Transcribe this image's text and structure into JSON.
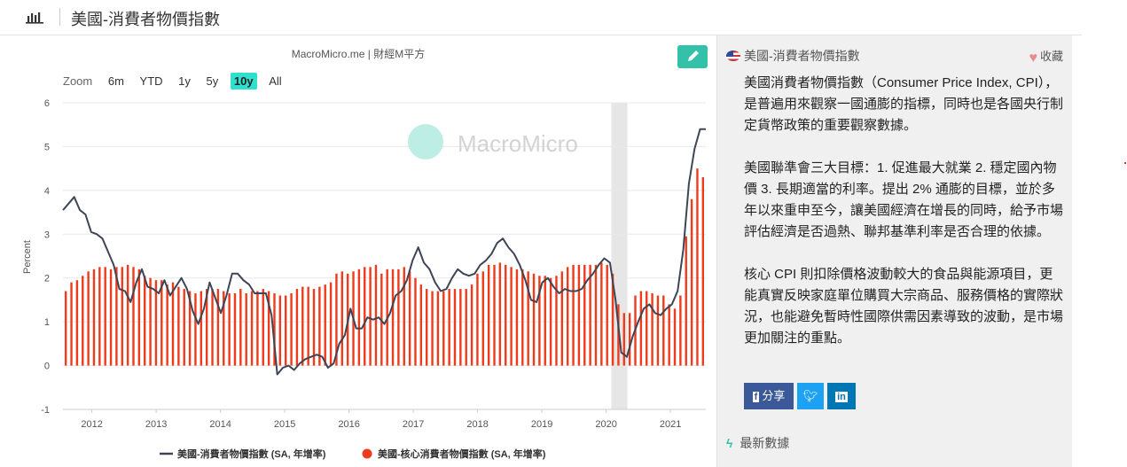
{
  "topbar": {
    "title": "美國-消費者物價指數"
  },
  "chart_panel": {
    "source": "MacroMicro.me | 財經M平方",
    "watermark": "MacroMicro",
    "zoom": {
      "label": "Zoom",
      "options": [
        "6m",
        "YTD",
        "1y",
        "5y",
        "10y",
        "All"
      ],
      "active": "10y"
    }
  },
  "chart_data": {
    "type": "bar",
    "ylabel": "Percent",
    "ylim": [
      -1,
      6
    ],
    "y_ticks": [
      "-1",
      "0",
      "1",
      "2",
      "3",
      "4",
      "5",
      "6"
    ],
    "x_ticks": [
      "2012",
      "2013",
      "2014",
      "2015",
      "2016",
      "2017",
      "2018",
      "2019",
      "2020",
      "2021"
    ],
    "x_start": 2011.55,
    "x_end": 2021.55,
    "shaded_period": [
      2020.08,
      2020.33
    ],
    "series": [
      {
        "name": "美國-消費者物價指數 (SA, 年增率)",
        "type": "line",
        "color": "#3d4556",
        "values": [
          3.55,
          3.7,
          3.85,
          3.55,
          3.45,
          3.05,
          3.0,
          2.9,
          2.6,
          2.3,
          1.75,
          1.7,
          1.45,
          1.9,
          2.2,
          1.8,
          1.75,
          1.65,
          1.95,
          1.6,
          1.8,
          2.0,
          1.75,
          1.25,
          0.95,
          1.3,
          1.9,
          1.55,
          1.2,
          1.6,
          2.1,
          2.1,
          1.95,
          1.85,
          1.65,
          1.65,
          1.65,
          1.15,
          -0.2,
          -0.05,
          0.0,
          -0.1,
          0.05,
          0.15,
          0.2,
          0.25,
          0.2,
          -0.05,
          0.05,
          0.5,
          0.7,
          1.3,
          0.85,
          0.85,
          1.1,
          1.05,
          1.1,
          0.95,
          1.2,
          1.6,
          1.7,
          1.95,
          2.4,
          2.7,
          2.35,
          2.2,
          1.9,
          1.7,
          1.75,
          2.0,
          2.2,
          2.1,
          2.05,
          2.1,
          2.3,
          2.4,
          2.55,
          2.8,
          2.9,
          2.7,
          2.55,
          2.3,
          1.95,
          1.5,
          1.45,
          1.9,
          2.0,
          1.8,
          1.65,
          1.75,
          1.7,
          1.7,
          1.75,
          1.95,
          2.1,
          2.3,
          2.45,
          2.35,
          1.5,
          0.3,
          0.2,
          0.65,
          1.0,
          1.3,
          1.4,
          1.2,
          1.15,
          1.3,
          1.4,
          1.7,
          2.65,
          4.15,
          4.95,
          5.4,
          5.4
        ]
      },
      {
        "name": "美國-核心消費者物價指數 (SA, 年增率)",
        "type": "bar",
        "color": "#ee3b1c",
        "values": [
          1.7,
          1.9,
          1.95,
          2.05,
          2.15,
          2.2,
          2.25,
          2.25,
          2.2,
          2.25,
          2.25,
          2.3,
          2.25,
          2.2,
          2.05,
          2.0,
          1.95,
          1.95,
          1.85,
          1.9,
          1.8,
          1.75,
          1.7,
          1.65,
          1.7,
          1.75,
          1.75,
          1.75,
          1.7,
          1.65,
          1.65,
          1.75,
          1.65,
          1.7,
          1.7,
          1.75,
          1.7,
          1.65,
          1.6,
          1.6,
          1.65,
          1.75,
          1.8,
          1.8,
          1.75,
          1.8,
          1.85,
          1.9,
          2.1,
          2.15,
          2.1,
          2.15,
          2.2,
          2.25,
          2.25,
          2.3,
          2.1,
          2.2,
          2.2,
          2.2,
          2.25,
          2.15,
          2.0,
          1.85,
          1.75,
          1.7,
          1.7,
          1.7,
          1.75,
          1.75,
          1.75,
          1.75,
          1.85,
          2.1,
          2.15,
          2.3,
          2.3,
          2.35,
          2.3,
          2.25,
          2.2,
          2.2,
          2.15,
          2.1,
          2.05,
          2.05,
          2.0,
          2.05,
          2.15,
          2.25,
          2.3,
          2.3,
          2.3,
          2.3,
          2.3,
          2.35,
          2.3,
          2.1,
          1.4,
          1.2,
          1.2,
          1.6,
          1.7,
          1.7,
          1.65,
          1.6,
          1.6,
          1.4,
          1.3,
          1.6,
          2.95,
          3.8,
          4.5,
          4.3
        ]
      }
    ],
    "legend_position": "bottom"
  },
  "side": {
    "header": "美國-消費者物價指數",
    "favorite": "收藏",
    "paragraphs": [
      "美國消費者物價指數（Consumer Price Index, CPI），是普遍用來觀察一國通膨的指標，同時也是各國央行制定貨幣政策的重要觀察數據。",
      "美國聯準會三大目標：1. 促進最大就業 2. 穩定國內物價 3. 長期適當的利率。提出 2% 通膨的目標，並於多年以來重申至今，讓美國經濟在增長的同時，給予市場評估經濟是否過熱、聯邦基準利率是否合理的依據。",
      "核心 CPI 則扣除價格波動較大的食品與能源項目，更能真實反映家庭單位購買大宗商品、服務價格的實際狀況，也能避免暫時性國際供需因素導致的波動，是市場更加關注的重點。"
    ],
    "share_label": "分享",
    "latest": "最新數據"
  },
  "colors": {
    "accent": "#33c2a9",
    "zoom_active": "#2fe0cf",
    "line": "#3d4556",
    "bar": "#ee3b1c"
  },
  "icons": {
    "topbar": "bar-chart-icon",
    "edit": "pencil-icon",
    "favorite": "heart-icon",
    "latest": "bolt-icon"
  }
}
